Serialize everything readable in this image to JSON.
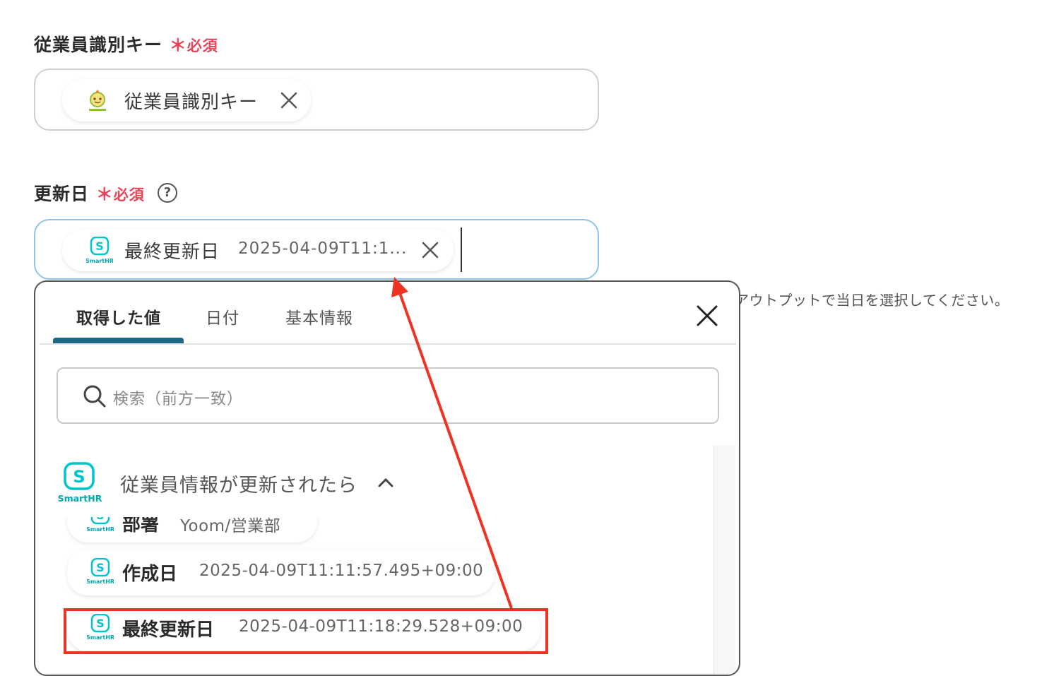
{
  "field1": {
    "label": "従業員識別キー",
    "required_star": "＊",
    "required_text": "必須",
    "chip": {
      "icon": "kingoftime-logo",
      "text": "従業員識別キー"
    }
  },
  "field2": {
    "label": "更新日",
    "required_star": "＊",
    "required_text": "必須",
    "chip": {
      "icon": "smarthr-logo",
      "text": "最終更新日",
      "value": "2025-04-09T11:1..."
    },
    "hint": "アウトプットで当日を選択してください。"
  },
  "panel": {
    "tabs": [
      {
        "label": "取得した値",
        "active": true
      },
      {
        "label": "日付",
        "active": false
      },
      {
        "label": "基本情報",
        "active": false
      }
    ],
    "search_placeholder": "検索（前方一致）",
    "group": {
      "icon": "smarthr-logo",
      "title": "従業員情報が更新されたら",
      "logo_text": "SmartHR"
    },
    "items": [
      {
        "label": "部署",
        "value": "Yoom/営業部"
      },
      {
        "label": "作成日",
        "value": "2025-04-09T11:11:57.495+09:00"
      },
      {
        "label": "最終更新日",
        "value": "2025-04-09T11:18:29.528+09:00"
      }
    ]
  },
  "colors": {
    "required": "#e8445a",
    "smarthr": "#00c4cc",
    "tab_indicator": "#1b6784",
    "annotation": "#ee3322",
    "focus_border": "#8ec4ec"
  }
}
